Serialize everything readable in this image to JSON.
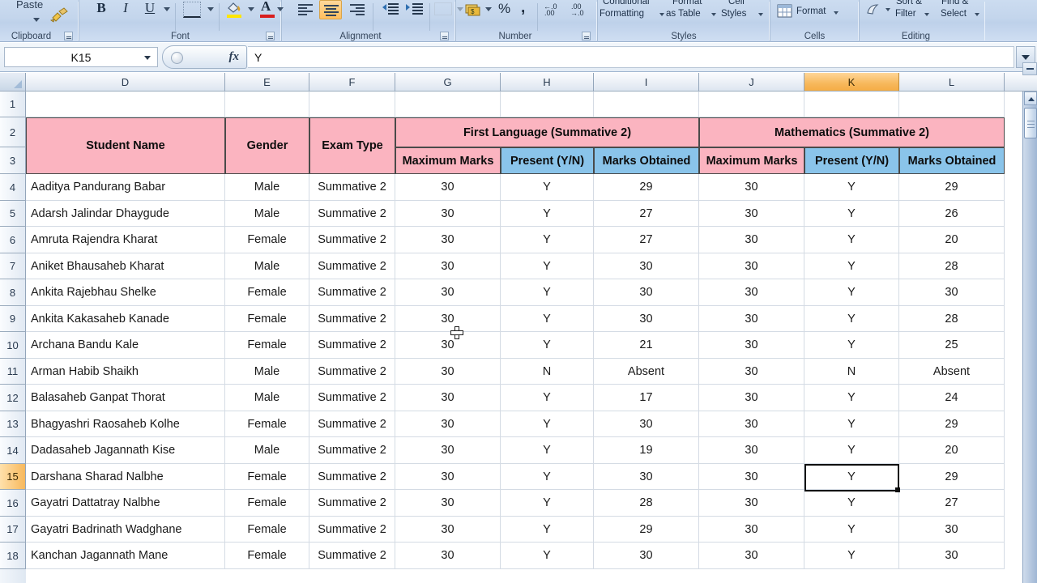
{
  "ribbon": {
    "groups": [
      {
        "name": "Clipboard",
        "label": "Clipboard"
      },
      {
        "name": "Font",
        "label": "Font"
      },
      {
        "name": "Alignment",
        "label": "Alignment"
      },
      {
        "name": "Number",
        "label": "Number"
      },
      {
        "name": "Styles",
        "label": "Styles"
      },
      {
        "name": "Cells",
        "label": "Cells"
      },
      {
        "name": "Editing",
        "label": "Editing"
      }
    ],
    "clipboard": {
      "paste_label": "Paste"
    },
    "font": {
      "bold": "B",
      "italic": "I",
      "underline": "U"
    },
    "number": {
      "percent": "%",
      "comma": ","
    },
    "styles": {
      "conditional_formatting_line1": "Conditional",
      "conditional_formatting_line2": "Formatting",
      "format_as_table_line1": "Format",
      "format_as_table_line2": "as Table",
      "cell_styles_line1": "Cell",
      "cell_styles_line2": "Styles"
    },
    "cells": {
      "format_label": "Format"
    },
    "editing": {
      "sort_filter_line1": "Sort &",
      "sort_filter_line2": "Filter",
      "find_select_line1": "Find &",
      "find_select_line2": "Select"
    }
  },
  "formula_bar": {
    "name_box_value": "K15",
    "fx_label": "fx",
    "formula_value": "Y"
  },
  "grid": {
    "columns": [
      "D",
      "E",
      "F",
      "G",
      "H",
      "I",
      "J",
      "K",
      "L"
    ],
    "selected_column": "K",
    "row_numbers": [
      1,
      2,
      3,
      4,
      5,
      6,
      7,
      8,
      9,
      10,
      11,
      12,
      13,
      14,
      15,
      16,
      17,
      18
    ],
    "selected_row": 15,
    "active_cell": "K15",
    "active_cell_value": "Y"
  },
  "table": {
    "group_headers": [
      {
        "label": "First Language (Summative 2)",
        "fill": "#fbb4c0"
      },
      {
        "label": "Mathematics (Summative 2)",
        "fill": "#fbb4c0"
      }
    ],
    "headers": [
      {
        "label": "Student Name",
        "fill": "#fbb4c0"
      },
      {
        "label": "Gender",
        "fill": "#fbb4c0"
      },
      {
        "label": "Exam Type",
        "fill": "#fbb4c0"
      },
      {
        "label": "Maximum Marks",
        "fill": "#fbb4c0"
      },
      {
        "label": "Present (Y/N)",
        "fill": "#8ac4ea"
      },
      {
        "label": "Marks Obtained",
        "fill": "#8ac4ea"
      },
      {
        "label": "Maximum Marks",
        "fill": "#fbb4c0"
      },
      {
        "label": "Present (Y/N)",
        "fill": "#8ac4ea"
      },
      {
        "label": "Marks Obtained",
        "fill": "#8ac4ea"
      }
    ],
    "rows": [
      {
        "row": 4,
        "name": "Aaditya Pandurang Babar",
        "gender": "Male",
        "exam": "Summative 2",
        "fl_max": "30",
        "fl_present": "Y",
        "fl_marks": "29",
        "m_max": "30",
        "m_present": "Y",
        "m_marks": "29"
      },
      {
        "row": 5,
        "name": "Adarsh Jalindar Dhaygude",
        "gender": "Male",
        "exam": "Summative 2",
        "fl_max": "30",
        "fl_present": "Y",
        "fl_marks": "27",
        "m_max": "30",
        "m_present": "Y",
        "m_marks": "26"
      },
      {
        "row": 6,
        "name": "Amruta Rajendra Kharat",
        "gender": "Female",
        "exam": "Summative 2",
        "fl_max": "30",
        "fl_present": "Y",
        "fl_marks": "27",
        "m_max": "30",
        "m_present": "Y",
        "m_marks": "20"
      },
      {
        "row": 7,
        "name": "Aniket Bhausaheb Kharat",
        "gender": "Male",
        "exam": "Summative 2",
        "fl_max": "30",
        "fl_present": "Y",
        "fl_marks": "30",
        "m_max": "30",
        "m_present": "Y",
        "m_marks": "28"
      },
      {
        "row": 8,
        "name": "Ankita Rajebhau Shelke",
        "gender": "Female",
        "exam": "Summative 2",
        "fl_max": "30",
        "fl_present": "Y",
        "fl_marks": "30",
        "m_max": "30",
        "m_present": "Y",
        "m_marks": "30"
      },
      {
        "row": 9,
        "name": "Ankita Kakasaheb Kanade",
        "gender": "Female",
        "exam": "Summative 2",
        "fl_max": "30",
        "fl_present": "Y",
        "fl_marks": "30",
        "m_max": "30",
        "m_present": "Y",
        "m_marks": "28"
      },
      {
        "row": 10,
        "name": "Archana Bandu Kale",
        "gender": "Female",
        "exam": "Summative 2",
        "fl_max": "30",
        "fl_present": "Y",
        "fl_marks": "21",
        "m_max": "30",
        "m_present": "Y",
        "m_marks": "25"
      },
      {
        "row": 11,
        "name": "Arman Habib Shaikh",
        "gender": "Male",
        "exam": "Summative 2",
        "fl_max": "30",
        "fl_present": "N",
        "fl_marks": "Absent",
        "m_max": "30",
        "m_present": "N",
        "m_marks": "Absent"
      },
      {
        "row": 12,
        "name": "Balasaheb Ganpat Thorat",
        "gender": "Male",
        "exam": "Summative 2",
        "fl_max": "30",
        "fl_present": "Y",
        "fl_marks": "17",
        "m_max": "30",
        "m_present": "Y",
        "m_marks": "24"
      },
      {
        "row": 13,
        "name": "Bhagyashri Raosaheb Kolhe",
        "gender": "Female",
        "exam": "Summative 2",
        "fl_max": "30",
        "fl_present": "Y",
        "fl_marks": "30",
        "m_max": "30",
        "m_present": "Y",
        "m_marks": "29"
      },
      {
        "row": 14,
        "name": "Dadasaheb Jagannath Kise",
        "gender": "Male",
        "exam": "Summative 2",
        "fl_max": "30",
        "fl_present": "Y",
        "fl_marks": "19",
        "m_max": "30",
        "m_present": "Y",
        "m_marks": "20"
      },
      {
        "row": 15,
        "name": "Darshana Sharad Nalbhe",
        "gender": "Female",
        "exam": "Summative 2",
        "fl_max": "30",
        "fl_present": "Y",
        "fl_marks": "30",
        "m_max": "30",
        "m_present": "Y",
        "m_marks": "29"
      },
      {
        "row": 16,
        "name": "Gayatri Dattatray Nalbhe",
        "gender": "Female",
        "exam": "Summative 2",
        "fl_max": "30",
        "fl_present": "Y",
        "fl_marks": "28",
        "m_max": "30",
        "m_present": "Y",
        "m_marks": "27"
      },
      {
        "row": 17,
        "name": "Gayatri Badrinath Wadghane",
        "gender": "Female",
        "exam": "Summative 2",
        "fl_max": "30",
        "fl_present": "Y",
        "fl_marks": "29",
        "m_max": "30",
        "m_present": "Y",
        "m_marks": "30"
      },
      {
        "row": 18,
        "name": "Kanchan Jagannath Mane",
        "gender": "Female",
        "exam": "Summative 2",
        "fl_max": "30",
        "fl_present": "Y",
        "fl_marks": "30",
        "m_max": "30",
        "m_present": "Y",
        "m_marks": "30"
      }
    ]
  },
  "colors": {
    "header_pink": "#fbb4c0",
    "header_blue": "#8ac4ea",
    "selection_orange": "#f7b85c",
    "ribbon_blue": "#c3d5ec"
  }
}
